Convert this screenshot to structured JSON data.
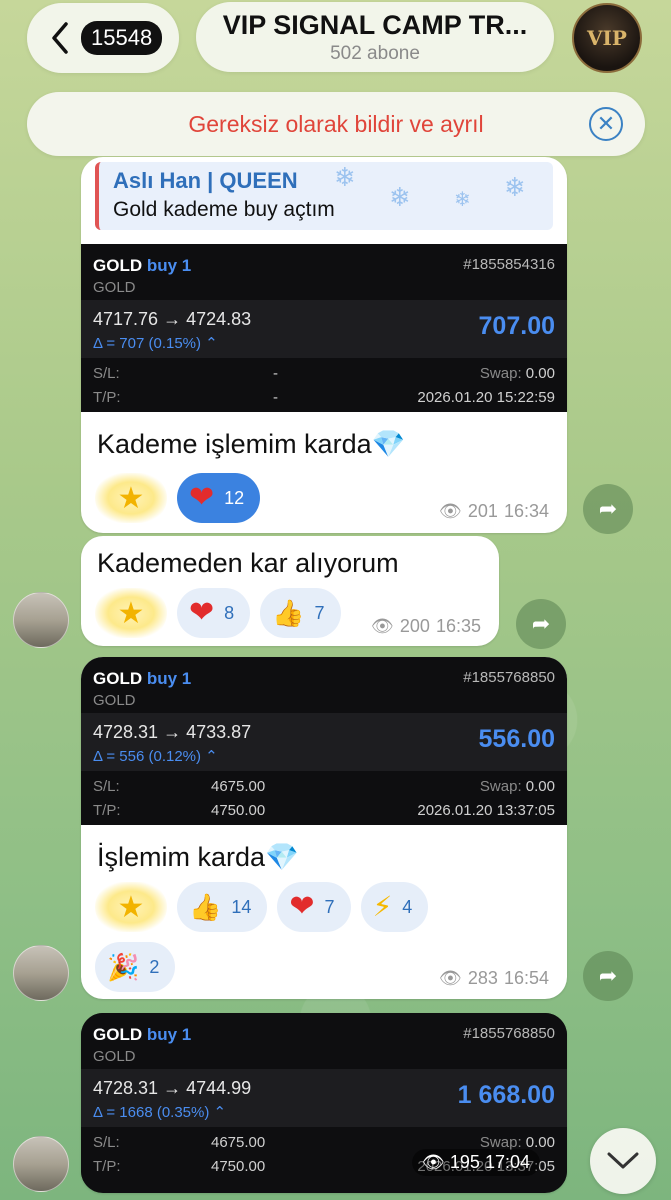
{
  "header": {
    "back_count": "15548",
    "channel_title": "VIP SIGNAL CAMP TR...",
    "subscribers": "502 abone",
    "avatar_text": "VIP"
  },
  "report_bar": {
    "text": "Gereksiz olarak bildir ve ayrıl"
  },
  "messages": [
    {
      "quote_name": "Aslı Han | QUEEN",
      "quote_text": "Gold kademe buy açtım",
      "trade": {
        "symbol": "GOLD",
        "direction": "buy 1",
        "sub": "GOLD",
        "id": "#1855854316",
        "prices": "4717.76 → 4724.83",
        "delta": "Δ = 707 (0.15%) ⌃",
        "profit": "707.00",
        "sl_label": "S/L:",
        "sl_value": "-",
        "tp_label": "T/P:",
        "tp_value": "-",
        "swap_label": "Swap:",
        "swap_value": "0.00",
        "timestamp": "2026.01.20 15:22:59"
      },
      "text": "Kademe işlemim karda💎",
      "reactions": [
        {
          "type": "heart",
          "count": "12",
          "active": true
        }
      ],
      "views": "201",
      "time": "16:34"
    },
    {
      "text": "Kademeden kar alıyorum",
      "reactions": [
        {
          "type": "heart",
          "count": "8"
        },
        {
          "type": "thumbs-up",
          "count": "7"
        }
      ],
      "views": "200",
      "time": "16:35"
    },
    {
      "trade": {
        "symbol": "GOLD",
        "direction": "buy 1",
        "sub": "GOLD",
        "id": "#1855768850",
        "prices": "4728.31 → 4733.87",
        "delta": "Δ = 556 (0.12%) ⌃",
        "profit": "556.00",
        "sl_label": "S/L:",
        "sl_value": "4675.00",
        "tp_label": "T/P:",
        "tp_value": "4750.00",
        "swap_label": "Swap:",
        "swap_value": "0.00",
        "timestamp": "2026.01.20 13:37:05"
      },
      "text": "İşlemim karda💎",
      "reactions": [
        {
          "type": "thumbs-up",
          "count": "14"
        },
        {
          "type": "heart",
          "count": "7"
        },
        {
          "type": "lightning",
          "count": "4"
        },
        {
          "type": "party",
          "count": "2"
        }
      ],
      "views": "283",
      "time": "16:54"
    },
    {
      "trade": {
        "symbol": "GOLD",
        "direction": "buy 1",
        "sub": "GOLD",
        "id": "#1855768850",
        "prices": "4728.31 → 4744.99",
        "delta": "Δ = 1668 (0.35%) ⌃",
        "profit": "1 668.00",
        "sl_label": "S/L:",
        "sl_value": "4675.00",
        "tp_label": "T/P:",
        "tp_value": "4750.00",
        "swap_label": "Swap:",
        "swap_value": "0.00",
        "timestamp": "2026.01.20 13:37:05"
      },
      "views": "195",
      "time": "17:04"
    }
  ],
  "icons": {
    "star": "★",
    "heart": "❤",
    "thumbs_up": "👍",
    "lightning": "⚡",
    "party": "🎉",
    "eye": "👁",
    "share": "➦"
  },
  "colors": {
    "accent_blue": "#3b82e0",
    "report_red": "#e0453a",
    "profit_blue": "#4a8df0",
    "trade_bg": "#0e0e10"
  }
}
